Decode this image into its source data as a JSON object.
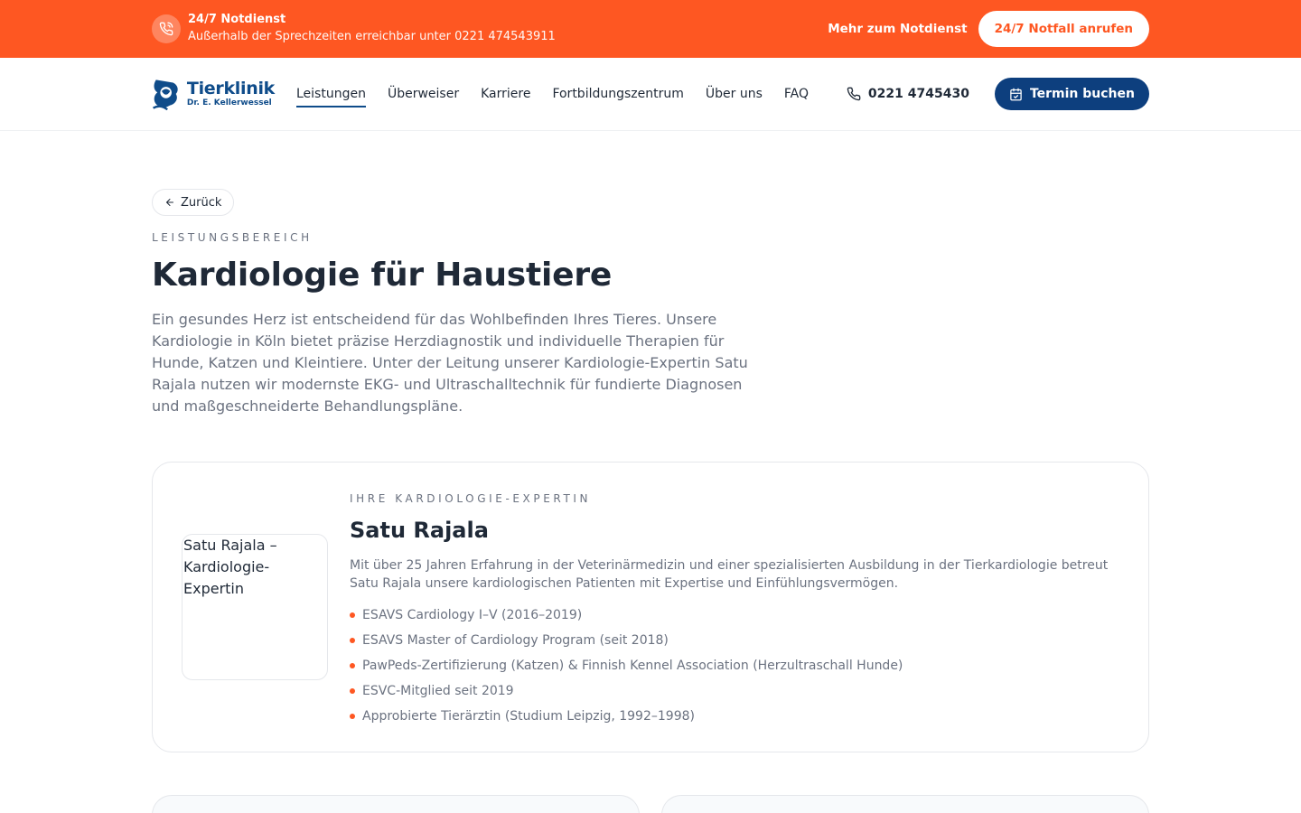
{
  "emergency_bar": {
    "title": "24/7 Notdienst",
    "subtitle": "Außerhalb der Sprechzeiten erreichbar unter 0221 474543911",
    "link_label": "Mehr zum Notdienst",
    "cta_label": "24/7 Notfall anrufen",
    "icon": "phone-call-icon",
    "color": "#fe5722"
  },
  "header": {
    "logo": {
      "name": "Tierklinik",
      "subtitle": "Dr. E. Kellerwessel"
    },
    "menu": [
      {
        "label": "Leistungen",
        "active": true
      },
      {
        "label": "Überweiser"
      },
      {
        "label": "Karriere"
      },
      {
        "label": "Fortbildungszentrum"
      },
      {
        "label": "Über uns"
      },
      {
        "label": "FAQ"
      }
    ],
    "phone": "0221 4745430",
    "book_label": "Termin buchen",
    "brand_color": "#0d3f7e"
  },
  "page": {
    "back_label": "Zurück",
    "eyebrow": "LEISTUNGSBEREICH",
    "title": "Kardiologie für Haustiere",
    "lead": "Ein gesundes Herz ist entscheidend für das Wohlbefinden Ihres Tieres. Unsere Kardiologie in Köln bietet präzise Herzdiagnostik und individuelle Therapien für Hunde, Katzen und Kleintiere. Unter der Leitung unserer Kardiologie-Expertin Satu Rajala nutzen wir modernste EKG- und Ultraschalltechnik für fundierte Diagnosen und maßgeschneiderte Behandlungspläne."
  },
  "expert": {
    "photo_alt": "Satu Rajala – Kardiologie-Expertin",
    "eyebrow": "IHRE KARDIOLOGIE-EXPERTIN",
    "name": "Satu Rajala",
    "text": "Mit über 25 Jahren Erfahrung in der Veterinärmedizin und einer spezialisierten Ausbildung in der Tierkardiologie betreut Satu Rajala unsere kardiologischen Patienten mit Expertise und Einfühlungsvermögen.",
    "credentials": [
      "ESAVS Cardiology I–V (2016–2019)",
      "ESAVS Master of Cardiology Program (seit 2018)",
      "PawPeds-Zertifizierung (Katzen) & Finnish Kennel Association (Herzultraschall Hunde)",
      "ESVC-Mitglied seit 2019",
      "Approbierte Tierärztin (Studium Leipzig, 1992–1998)"
    ]
  }
}
